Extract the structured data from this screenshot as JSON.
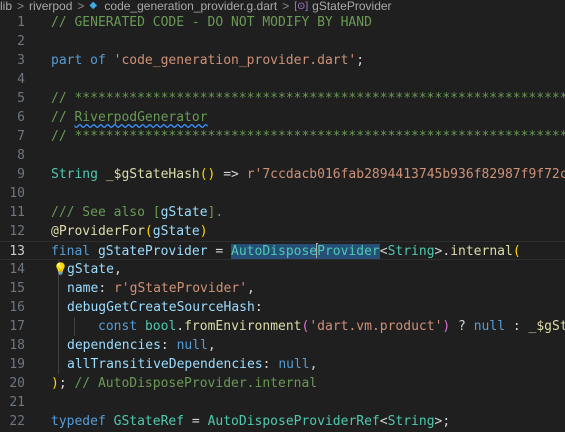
{
  "breadcrumb": {
    "items": [
      "lib",
      "riverpod",
      "code_generation_provider.g.dart",
      "gStateProvider"
    ],
    "separator": ">"
  },
  "editor": {
    "current_line": 13,
    "line_numbers": [
      "1",
      "2",
      "3",
      "4",
      "5",
      "6",
      "7",
      "8",
      "9",
      "10",
      "11",
      "12",
      "13",
      "14",
      "15",
      "16",
      "17",
      "18",
      "19",
      "20",
      "21",
      "22",
      "23"
    ],
    "code": {
      "l1": "// GENERATED CODE - DO NOT MODIFY BY HAND",
      "l3_kw": "part of",
      "l3_str": "'code_generation_provider.dart'",
      "l3_end": ";",
      "l5": "// **************************************************************************",
      "l6_prefix": "// ",
      "l6_word": "RiverpodGenerator",
      "l7": "// **************************************************************************",
      "l9_type": "String",
      "l9_fn": "_$gStateHash",
      "l9_mid": " => ",
      "l9_str": "r'7ccdacb016fab2894413745b936f82987f9f72cf",
      "l11_pre": "/// See also [",
      "l11_ref": "gState",
      "l11_post": "].",
      "l12_anno": "@ProviderFor",
      "l12_arg": "gState",
      "l13_kw": "final",
      "l13_var": "gStateProvider",
      "l13_eq": " = ",
      "l13_cls_a": "AutoDispose",
      "l13_cls_b": "Provider",
      "l13_lt": "<",
      "l13_type": "String",
      "l13_gt": ">",
      "l13_dot": ".",
      "l13_fn": "internal",
      "l14": "gState",
      "l15_key": "name",
      "l15_str": "r'gStateProvider'",
      "l16_key": "debugGetCreateSourceHash",
      "l17_kw": "const",
      "l17_type": "bool",
      "l17_fn": "fromEnvironment",
      "l17_str": "'dart.vm.product'",
      "l17_q": " ? ",
      "l17_null": "null",
      "l17_colon": " : ",
      "l17_tail": "_$gSta",
      "l18_key": "dependencies",
      "l18_null": "null",
      "l19_key": "allTransitiveDependencies",
      "l19_null": "null",
      "l20_close": ")",
      "l20_semi": "; ",
      "l20_comment": "// AutoDisposeProvider.internal",
      "l22_kw": "typedef",
      "l22_cls": "GStateRef",
      "l22_eq": " = ",
      "l22_cls2": "AutoDisposeProviderRef",
      "l22_lt": "<",
      "l22_type": "String",
      "l22_gt": ">;"
    }
  },
  "colors": {
    "background": "#1f1f1f",
    "comment": "#6a9955",
    "keyword": "#569cd6",
    "string": "#ce9178",
    "class": "#4ec9b0",
    "function": "#dcdcaa",
    "variable": "#9cdcfe",
    "selection": "#264f78"
  },
  "icons": [
    "dart-file-icon",
    "symbol-variable-icon",
    "lightbulb-icon"
  ]
}
